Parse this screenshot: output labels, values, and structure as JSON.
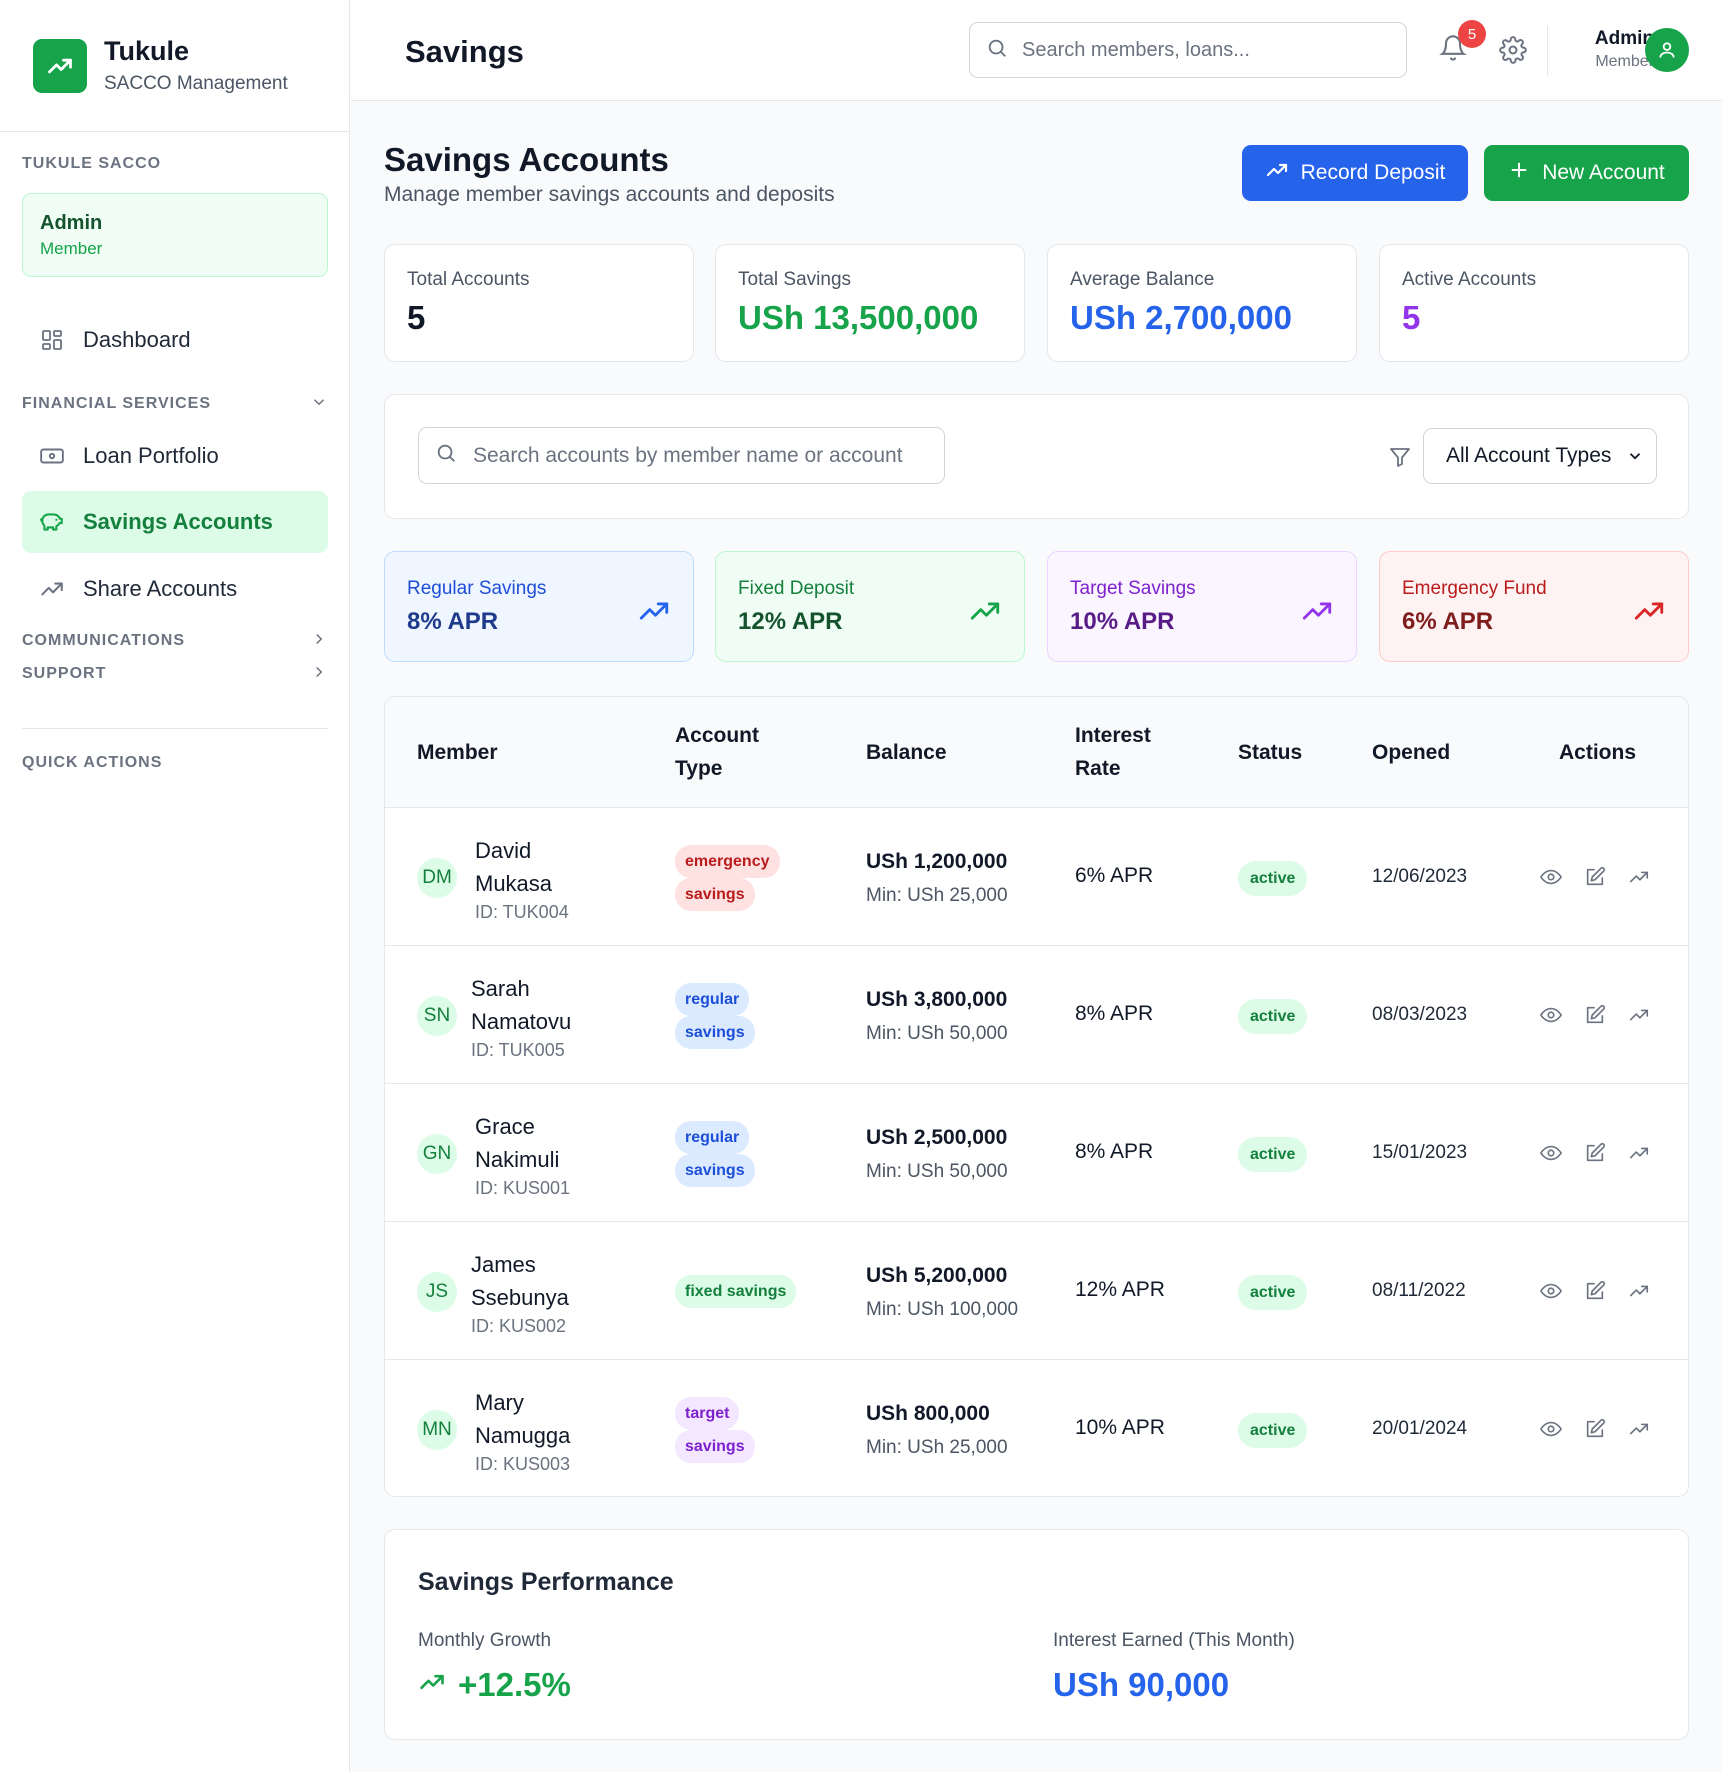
{
  "brand": {
    "name": "Tukule",
    "subtitle": "SACCO Management"
  },
  "sidebar": {
    "org_label": "TUKULE SACCO",
    "user": {
      "name": "Admin",
      "role": "Member"
    },
    "dashboard": "Dashboard",
    "financial_label": "FINANCIAL SERVICES",
    "loan_portfolio": "Loan Portfolio",
    "savings_accounts": "Savings Accounts",
    "share_accounts": "Share Accounts",
    "communications_label": "COMMUNICATIONS",
    "support_label": "SUPPORT",
    "quick_actions_label": "QUICK ACTIONS"
  },
  "header": {
    "title": "Savings",
    "search_placeholder": "Search members, loans...",
    "notification_count": "5",
    "user_name": "Admin",
    "user_role": "Member"
  },
  "page": {
    "title": "Savings Accounts",
    "subtitle": "Manage member savings accounts and deposits",
    "record_deposit": "Record Deposit",
    "new_account": "New Account"
  },
  "stats": [
    {
      "label": "Total Accounts",
      "value": "5",
      "color": "#111827"
    },
    {
      "label": "Total Savings",
      "value": "USh 13,500,000",
      "color": "#16a34a"
    },
    {
      "label": "Average Balance",
      "value": "USh 2,700,000",
      "color": "#2563eb"
    },
    {
      "label": "Active Accounts",
      "value": "5",
      "color": "#9333ea"
    }
  ],
  "filters": {
    "search_placeholder": "Search accounts by member name or account",
    "type_selected": "All Account Types"
  },
  "account_types": [
    {
      "label": "Regular Savings",
      "rate": "8% APR",
      "bg": "#eff6ff",
      "border": "#bfdbfe",
      "label_color": "#1d4ed8",
      "value_color": "#1e3a8a",
      "icon_color": "#2563eb"
    },
    {
      "label": "Fixed Deposit",
      "rate": "12% APR",
      "bg": "#f0fdf4",
      "border": "#bbf7d0",
      "label_color": "#15803d",
      "value_color": "#14532d",
      "icon_color": "#16a34a"
    },
    {
      "label": "Target Savings",
      "rate": "10% APR",
      "bg": "#faf5ff",
      "border": "#e9d5ff",
      "label_color": "#7e22ce",
      "value_color": "#581c87",
      "icon_color": "#9333ea"
    },
    {
      "label": "Emergency Fund",
      "rate": "6% APR",
      "bg": "#fef2f2",
      "border": "#fecaca",
      "label_color": "#b91c1c",
      "value_color": "#7f1d1d",
      "icon_color": "#dc2626"
    }
  ],
  "table": {
    "headers": {
      "member": "Member",
      "account_type_1": "Account",
      "account_type_2": "Type",
      "balance": "Balance",
      "interest_1": "Interest",
      "interest_2": "Rate",
      "status": "Status",
      "opened": "Opened",
      "actions": "Actions"
    },
    "rows": [
      {
        "initials": "DM",
        "first": "David",
        "last": "Mukasa",
        "id": "ID: TUK004",
        "type1": "emergency",
        "type2": "savings",
        "type_bg": "#fee2e2",
        "type_color": "#b91c1c",
        "balance": "USh 1,200,000",
        "min": "Min: USh 25,000",
        "rate": "6% APR",
        "status": "active",
        "opened": "12/06/2023"
      },
      {
        "initials": "SN",
        "first": "Sarah",
        "last": "Namatovu",
        "id": "ID: TUK005",
        "type1": "regular",
        "type2": "savings",
        "type_bg": "#dbeafe",
        "type_color": "#1d4ed8",
        "balance": "USh 3,800,000",
        "min": "Min: USh 50,000",
        "rate": "8% APR",
        "status": "active",
        "opened": "08/03/2023"
      },
      {
        "initials": "GN",
        "first": "Grace",
        "last": "Nakimuli",
        "id": "ID: KUS001",
        "type1": "regular",
        "type2": "savings",
        "type_bg": "#dbeafe",
        "type_color": "#1d4ed8",
        "balance": "USh 2,500,000",
        "min": "Min: USh 50,000",
        "rate": "8% APR",
        "status": "active",
        "opened": "15/01/2023"
      },
      {
        "initials": "JS",
        "first": "James",
        "last": "Ssebunya",
        "id": "ID: KUS002",
        "type1": "fixed savings",
        "type2": "",
        "type_bg": "#dcfce7",
        "type_color": "#15803d",
        "balance": "USh 5,200,000",
        "min": "Min: USh 100,000",
        "rate": "12% APR",
        "status": "active",
        "opened": "08/11/2022"
      },
      {
        "initials": "MN",
        "first": "Mary",
        "last": "Namugga",
        "id": "ID: KUS003",
        "type1": "target",
        "type2": "savings",
        "type_bg": "#f3e8ff",
        "type_color": "#7e22ce",
        "balance": "USh 800,000",
        "min": "Min: USh 25,000",
        "rate": "10% APR",
        "status": "active",
        "opened": "20/01/2024"
      }
    ]
  },
  "performance": {
    "title": "Savings Performance",
    "growth_label": "Monthly Growth",
    "growth_value": "+12.5%",
    "interest_label": "Interest Earned (This Month)",
    "interest_value": "USh 90,000"
  },
  "colors": {
    "primary_green": "#16a34a",
    "primary_blue": "#2563eb"
  }
}
